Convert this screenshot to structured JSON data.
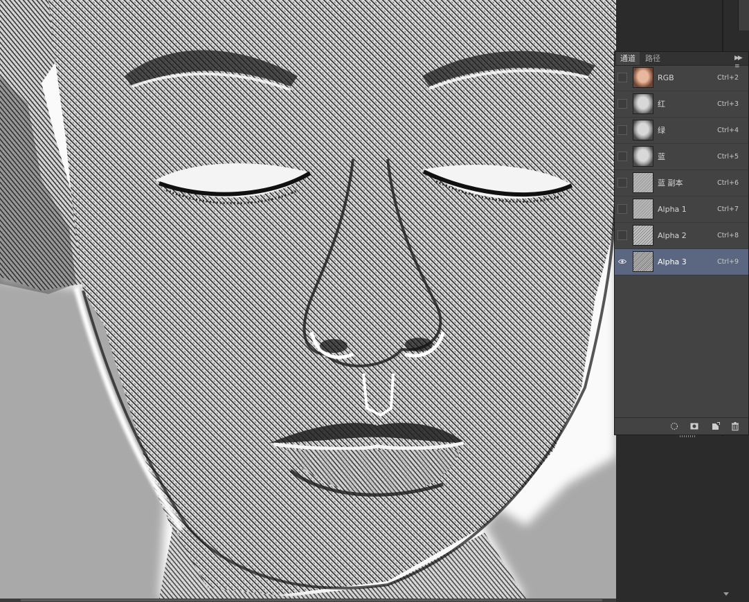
{
  "panel": {
    "tabs": [
      {
        "label": "通道",
        "active": true
      },
      {
        "label": "路径",
        "active": false
      }
    ],
    "menu_icon": "panel-menu-icon",
    "channels": [
      {
        "name": "RGB",
        "shortcut": "Ctrl+2",
        "thumb": "color",
        "visible": false,
        "selected": false
      },
      {
        "name": "红",
        "shortcut": "Ctrl+3",
        "thumb": "gray",
        "visible": false,
        "selected": false
      },
      {
        "name": "绿",
        "shortcut": "Ctrl+4",
        "thumb": "gray",
        "visible": false,
        "selected": false
      },
      {
        "name": "蓝",
        "shortcut": "Ctrl+5",
        "thumb": "gray",
        "visible": false,
        "selected": false
      },
      {
        "name": "蓝 副本",
        "shortcut": "Ctrl+6",
        "thumb": "emboss",
        "visible": false,
        "selected": false
      },
      {
        "name": "Alpha 1",
        "shortcut": "Ctrl+7",
        "thumb": "emboss",
        "visible": false,
        "selected": false
      },
      {
        "name": "Alpha 2",
        "shortcut": "Ctrl+8",
        "thumb": "emboss2",
        "visible": false,
        "selected": false
      },
      {
        "name": "Alpha 3",
        "shortcut": "Ctrl+9",
        "thumb": "emboss3",
        "visible": true,
        "selected": true
      }
    ],
    "footer_icons": [
      "load-selection-icon",
      "save-selection-mask-icon",
      "new-channel-icon",
      "delete-channel-icon"
    ]
  },
  "colors": {
    "panel_bg": "#434343",
    "selected_row": "#5b6780",
    "canvas_bg": "#a9a9a9"
  },
  "canvas": {
    "image": "embossed high-pass face, eyes closed"
  }
}
